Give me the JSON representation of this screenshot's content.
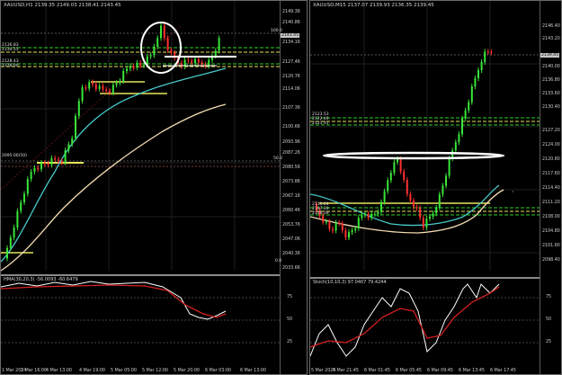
{
  "left": {
    "title": "XAUUSD,H1",
    "ohlc": "XAUUSD,H1  2139.35 2149.03 2138.41 2143.45",
    "indicator_title": "HMA(30,20,3) -56.0093 -60.6479",
    "price_labels": [
      "2149.36",
      "2140.86",
      "2134.16",
      "2127.46",
      "2120.76",
      "2114.06",
      "2107.36",
      "2100.66",
      "2093.96",
      "2087.26",
      "2080.56",
      "2073.86",
      "2067.16",
      "2060.46",
      "2053.76",
      "2047.06",
      "2040.36",
      "2033.66",
      "2026.96",
      "2020.26",
      "2013.56"
    ],
    "level_labels": {
      "l100": "100.0",
      "l50": "50.0",
      "l0": "0.0"
    },
    "line_labels": [
      "2136.83",
      "2134.55",
      "2128.43",
      "2128.00"
    ],
    "fib_label": "2095.00(50)",
    "current_price": "2143.45",
    "indicator_levels": [
      "75",
      "50",
      "25"
    ],
    "time_labels": [
      "1 Mar 2024",
      "1 Mar 16:00",
      "4 Mar 13:00",
      "4 Mar 19:00",
      "5 Mar 05:00",
      "5 Mar 12:00",
      "5 Mar 20:00",
      "6 Mar 03:00",
      "6 Mar 13:00"
    ]
  },
  "right": {
    "title": "XAUUSD,M15",
    "ohlc": "XAUUSD,M15  2137.07 2139.93 2136.35 2139.45",
    "indicator_title": "Stoch(10,10,3) 97.0407 79.4244",
    "price_labels": [
      "2146.40",
      "2143.20",
      "2140.00",
      "2136.80",
      "2133.60",
      "2130.40",
      "2127.20",
      "2124.00",
      "2120.80",
      "2117.60",
      "2114.40",
      "2111.20",
      "2108.00",
      "2104.80",
      "2101.60",
      "2098.40",
      "2095.20",
      "2092.00",
      "2088.80",
      "2085.60",
      "2082.40",
      "2079.20",
      "2076.00",
      "2072.80"
    ],
    "current_price": "2139.45",
    "line_labels": [
      "2123.53",
      "2122.46",
      "2121.91",
      "2110.04",
      "2107.30",
      "2106.39"
    ],
    "indicator_levels": [
      "75",
      "50",
      "25"
    ],
    "time_labels": [
      "5 Mar 2024",
      "5 Mar 21:45",
      "6 Mar 01:45",
      "6 Mar 05:45",
      "6 Mar 09:45",
      "6 Mar 13:45",
      "6 Mar 17:45"
    ]
  },
  "colors": {
    "bull": "#39e639",
    "bear": "#ff3030",
    "ma_fast": "#48c8c8",
    "ma_slow": "#f5deb3",
    "green_line": "#2bd12b",
    "yellow_line": "#e6e65c",
    "annotation": "#ffffff"
  }
}
